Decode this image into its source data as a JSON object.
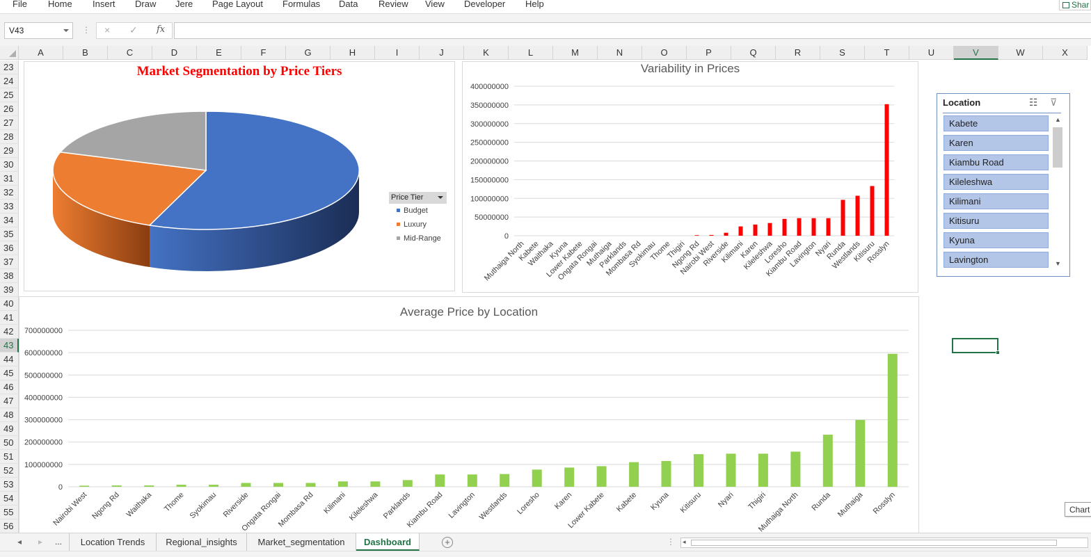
{
  "ribbon": {
    "tabs": [
      "File",
      "Home",
      "Insert",
      "Draw",
      "Jere",
      "Page Layout",
      "Formulas",
      "Data",
      "Review",
      "View",
      "Developer",
      "Help"
    ],
    "share_label": "Shar"
  },
  "formula_bar": {
    "name_box": "V43",
    "cancel_icon": "×",
    "enter_icon": "✓",
    "fx_label": "fx",
    "formula": ""
  },
  "grid": {
    "columns": [
      "A",
      "B",
      "C",
      "D",
      "E",
      "F",
      "G",
      "H",
      "I",
      "J",
      "K",
      "L",
      "M",
      "N",
      "O",
      "P",
      "Q",
      "R",
      "S",
      "T",
      "U",
      "V",
      "W",
      "X"
    ],
    "selected_column": "V",
    "rows": [
      "23",
      "24",
      "25",
      "26",
      "27",
      "28",
      "29",
      "30",
      "31",
      "32",
      "33",
      "34",
      "35",
      "36",
      "37",
      "38",
      "39",
      "40",
      "41",
      "42",
      "43",
      "44",
      "45",
      "46",
      "47",
      "48",
      "49",
      "50",
      "51",
      "52",
      "53",
      "54",
      "55",
      "56"
    ],
    "selected_row": "43"
  },
  "charts": {
    "pie_title": "Market Segmentation by Price Tiers",
    "pie_legend_title": "Price Tier",
    "variability_title": "Variability in Prices",
    "average_title": "Average Price by Location",
    "tooltip": "Chart"
  },
  "chart_data": [
    {
      "type": "pie",
      "title": "Market Segmentation by Price Tiers",
      "legend_title": "Price Tier",
      "legend_position": "right",
      "three_d": true,
      "categories": [
        "Budget",
        "Luxury",
        "Mid-Range"
      ],
      "values": [
        56,
        24,
        20
      ],
      "colors": [
        "#4472c4",
        "#ed7d31",
        "#a5a5a5"
      ]
    },
    {
      "type": "bar",
      "title": "Variability in Prices",
      "color": "#ff0000",
      "ylim": [
        0,
        400000000
      ],
      "yticks": [
        0,
        50000000,
        100000000,
        150000000,
        200000000,
        250000000,
        300000000,
        350000000,
        400000000
      ],
      "grid": true,
      "categories": [
        "Muthaiga North",
        "Kabete",
        "Waithaka",
        "Kyuna",
        "Lower Kabete",
        "Ongata Rongai",
        "Muthaiga",
        "Parklands",
        "Mombasa Rd",
        "Syokimau",
        "Thome",
        "Thigiri",
        "Ngong Rd",
        "Nairobi West",
        "Riverside",
        "Kilimani",
        "Karen",
        "Kileleshwa",
        "Loresho",
        "Kiambu Road",
        "Lavington",
        "Nyari",
        "Runda",
        "Westlands",
        "Kitisuru",
        "Rosslyn"
      ],
      "values": [
        0,
        0,
        0,
        0,
        0,
        0,
        0,
        0,
        0,
        0,
        0,
        0,
        1500000,
        2000000,
        8000000,
        25000000,
        30000000,
        34000000,
        45000000,
        47000000,
        47000000,
        47000000,
        96000000,
        107000000,
        133000000,
        352000000
      ]
    },
    {
      "type": "bar",
      "title": "Average Price by Location",
      "color": "#92d050",
      "ylim": [
        0,
        700000000
      ],
      "yticks": [
        0,
        100000000,
        200000000,
        300000000,
        400000000,
        500000000,
        600000000,
        700000000
      ],
      "grid": true,
      "categories": [
        "Nairobi West",
        "Ngong Rd",
        "Waithaka",
        "Thome",
        "Syokimau",
        "Riverside",
        "Ongata Rongai",
        "Mombasa Rd",
        "Kilimani",
        "Kileleshwa",
        "Parklands",
        "Kiambu Road",
        "Lavington",
        "Westlands",
        "Loresho",
        "Karen",
        "Lower Kabete",
        "Kabete",
        "Kyuna",
        "Kitisuru",
        "Nyari",
        "Thigiri",
        "Muthaiga North",
        "Runda",
        "Muthaiga",
        "Rosslyn"
      ],
      "values": [
        5000000,
        6000000,
        6000000,
        9000000,
        9000000,
        17000000,
        17000000,
        17000000,
        24000000,
        24000000,
        30000000,
        55000000,
        55000000,
        57000000,
        77000000,
        86000000,
        92000000,
        110000000,
        115000000,
        146000000,
        148000000,
        148000000,
        157000000,
        233000000,
        299000000,
        595000000
      ]
    }
  ],
  "slicer": {
    "title": "Location",
    "multiselect_icon": "multi-select-icon",
    "clear_icon": "clear-filter-icon",
    "items": [
      "Kabete",
      "Karen",
      "Kiambu Road",
      "Kileleshwa",
      "Kilimani",
      "Kitisuru",
      "Kyuna",
      "Lavington"
    ]
  },
  "sheet_tabs": {
    "ellipsis": "...",
    "tabs": [
      "Location Trends",
      "Regional_insights",
      "Market_segmentation",
      "Dashboard"
    ],
    "active": "Dashboard",
    "add_icon": "+"
  }
}
